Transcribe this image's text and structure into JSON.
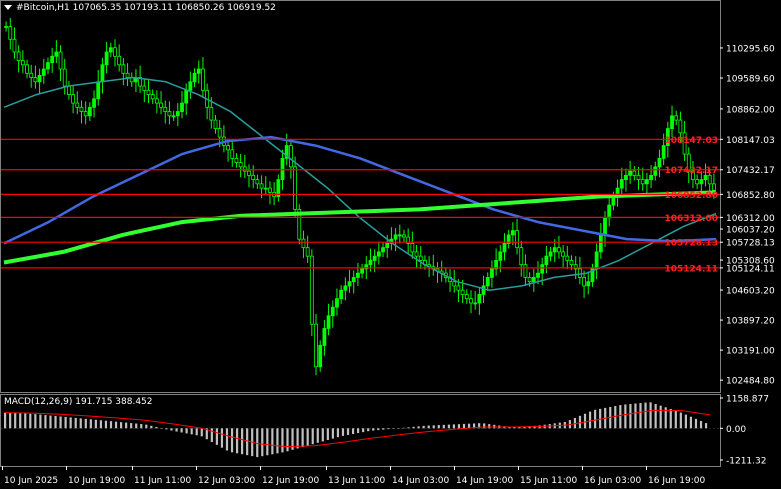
{
  "header": {
    "symbol": "#Bitcoin,H1",
    "ohlc": "107065.35 107193.11 106850.26 106919.52"
  },
  "macd": {
    "label": "MACD(12,26,9) 191.715 388.452",
    "scale": [
      "1158.877",
      "0.00",
      "-1211.32"
    ]
  },
  "price_axis": {
    "labels": [
      "110295.60",
      "109589.60",
      "108862.00",
      "108147.03",
      "107432.17",
      "106852.80",
      "106312.00",
      "106037.20",
      "105728.13",
      "105308.60",
      "105124.11",
      "104603.20",
      "103897.20",
      "103191.00",
      "102484.80"
    ]
  },
  "levels": {
    "values": [
      "108147.03",
      "107432.17",
      "106852.80",
      "106312.00",
      "105728.13",
      "105124.11"
    ],
    "color": "#ff0000"
  },
  "time_axis": {
    "labels": [
      "10 Jun 2025",
      "10 Jun 19:00",
      "11 Jun 11:00",
      "12 Jun 03:00",
      "12 Jun 19:00",
      "13 Jun 11:00",
      "14 Jun 03:00",
      "14 Jun 19:00",
      "15 Jun 11:00",
      "16 Jun 03:00",
      "16 Jun 19:00"
    ]
  },
  "colors": {
    "background": "#000000",
    "candle": "#00ff00",
    "ma_fast": "#2a9d9d",
    "ma_mid": "#4169e1",
    "ma_slow": "#32ff32",
    "macd_hist": "#c0c0c0",
    "macd_signal": "#ff0000"
  },
  "chart_data": {
    "type": "candlestick",
    "series": [
      {
        "name": "price",
        "values": [
          110800,
          110500,
          110200,
          110000,
          109900,
          109700,
          109600,
          109500,
          109650,
          109800,
          109950,
          110100,
          110200,
          109800,
          109400,
          109200,
          109000,
          108900,
          108800,
          108700,
          108900,
          109100,
          109500,
          109900,
          110200,
          110300,
          110100,
          109900,
          109700,
          109600,
          109500,
          109600,
          109400,
          109300,
          109200,
          109100,
          109000,
          108900,
          108800,
          108700,
          108700,
          108800,
          109000,
          109300,
          109500,
          109700,
          109800,
          109300,
          108900,
          108600,
          108400,
          108200,
          108000,
          107900,
          107700,
          107600,
          107500,
          107400,
          107300,
          107200,
          107100,
          107000,
          107000,
          106900,
          106800,
          107200,
          107700,
          108000,
          107500,
          106500,
          105800,
          105600,
          105400,
          103800,
          102800,
          103300,
          103700,
          104000,
          104200,
          104400,
          104600,
          104700,
          104800,
          104900,
          105000,
          105100,
          105200,
          105300,
          105400,
          105500,
          105600,
          105700,
          105800,
          105900,
          105900,
          105850,
          105700,
          105500,
          105400,
          105300,
          105200,
          105150,
          105100,
          105050,
          105000,
          104900,
          104800,
          104700,
          104600,
          104500,
          104400,
          104300,
          104300,
          104500,
          104700,
          104900,
          105100,
          105300,
          105500,
          105700,
          105900,
          106000,
          105600,
          105200,
          104900,
          104800,
          104900,
          105000,
          105200,
          105400,
          105500,
          105600,
          105500,
          105400,
          105300,
          105200,
          105100,
          104900,
          104700,
          104800,
          105100,
          105500,
          105900,
          106300,
          106600,
          106800,
          107000,
          107200,
          107300,
          107400,
          107300,
          107200,
          107100,
          107200,
          107300,
          107500,
          107700,
          108000,
          108400,
          108700,
          108600,
          108300,
          107800,
          107400,
          107200,
          107100,
          107200,
          107300,
          107100,
          106950
        ]
      },
      {
        "name": "MA fast",
        "values": [
          108900,
          109200,
          109400,
          109500,
          109600,
          109500,
          109200,
          108800,
          108200,
          107600,
          107000,
          106300,
          105700,
          105200,
          104800,
          104600,
          104700,
          104900,
          105000,
          105300,
          105700,
          106100,
          106400
        ]
      },
      {
        "name": "MA mid",
        "values": [
          105700,
          106200,
          106800,
          107300,
          107800,
          108100,
          108200,
          108000,
          107700,
          107300,
          106900,
          106500,
          106200,
          106000,
          105800,
          105750,
          105800
        ]
      },
      {
        "name": "MA slow",
        "values": [
          105250,
          105500,
          105900,
          106200,
          106350,
          106400,
          106450,
          106500,
          106600,
          106700,
          106800,
          106850,
          106900
        ]
      },
      {
        "name": "MACD",
        "values": [
          600,
          550,
          450,
          350,
          250,
          150,
          -100,
          -300,
          -900,
          -1100,
          -900,
          -600,
          -300,
          -100,
          0,
          100,
          150,
          200,
          50,
          100,
          250,
          700,
          900,
          1000,
          650,
          200
        ]
      }
    ]
  }
}
